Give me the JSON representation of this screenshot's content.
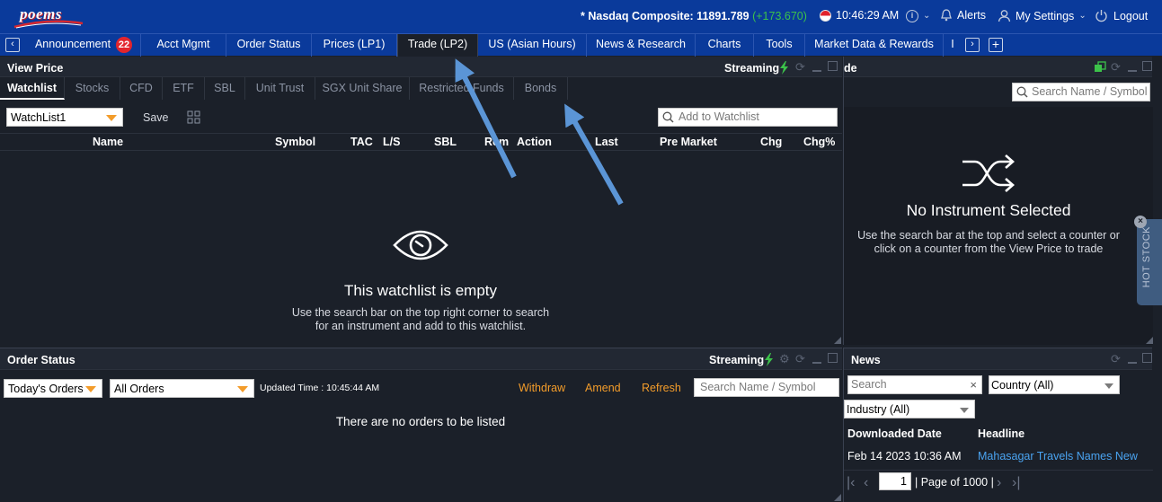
{
  "header": {
    "logo_text": "poems",
    "index_label": "* Nasdaq Composite: 11891.789",
    "index_change": "(+173.670)",
    "time": "10:46:29 AM",
    "alerts_label": "Alerts",
    "settings_label": "My Settings",
    "logout_label": "Logout"
  },
  "nav": {
    "tabs": [
      {
        "label": "Announcement",
        "badge": "22"
      },
      {
        "label": "Acct Mgmt"
      },
      {
        "label": "Order Status"
      },
      {
        "label": "Prices (LP1)"
      },
      {
        "label": "Trade (LP2)",
        "active": true
      },
      {
        "label": "US (Asian Hours)"
      },
      {
        "label": "News & Research"
      },
      {
        "label": "Charts"
      },
      {
        "label": "Tools"
      },
      {
        "label": "Market Data & Rewards"
      },
      {
        "label": "I"
      }
    ]
  },
  "view_price": {
    "title": "View Price",
    "streaming": "Streaming",
    "subtabs": [
      "Watchlist",
      "Stocks",
      "CFD",
      "ETF",
      "SBL",
      "Unit Trust",
      "SGX Unit Share",
      "Restricted Funds",
      "Bonds"
    ],
    "watchlist_select": "WatchList1",
    "save_label": "Save",
    "add_placeholder": "Add to Watchlist",
    "columns": [
      "Name",
      "Symbol",
      "TAC",
      "L/S",
      "SBL",
      "Rem",
      "Action",
      "Last",
      "Pre Market",
      "Chg",
      "Chg%"
    ],
    "empty_title": "This watchlist is empty",
    "empty_line1": "Use the search bar on the top right corner to search",
    "empty_line2": "for an instrument and add to this watchlist."
  },
  "trade": {
    "title": "de",
    "search_placeholder": "Search Name / Symbol",
    "empty_title": "No Instrument Selected",
    "empty_line1": "Use the search bar at the top and select a counter or",
    "empty_line2": "click on a counter from the View Price to trade",
    "hot_stock": "HOT STOCK"
  },
  "order_status": {
    "title": "Order Status",
    "streaming": "Streaming",
    "period_select": "Today's Orders",
    "orders_select": "All Orders",
    "updated_time": "Updated Time : 10:45:44 AM",
    "withdraw": "Withdraw",
    "amend": "Amend",
    "refresh": "Refresh",
    "search_placeholder": "Search Name / Symbol",
    "empty": "There are no orders to be listed"
  },
  "news": {
    "title": "News",
    "search_placeholder": "Search",
    "country_select": "Country (All)",
    "industry_select": "Industry (All)",
    "col_date": "Downloaded Date",
    "col_headline": "Headline",
    "row_date": "Feb 14 2023 10:36 AM",
    "row_headline": "Mahasagar Travels Names New",
    "page_input": "1",
    "page_of": "| Page of 1000 |"
  },
  "colors": {
    "header_blue": "#0a3a9b",
    "panel_bg": "#1b2029",
    "accent_orange": "#f39c2a",
    "positive_green": "#3cc24a",
    "link_blue": "#4aa3f0",
    "badge_red": "#e3252d",
    "annotation_arrow": "#5b95d6"
  }
}
